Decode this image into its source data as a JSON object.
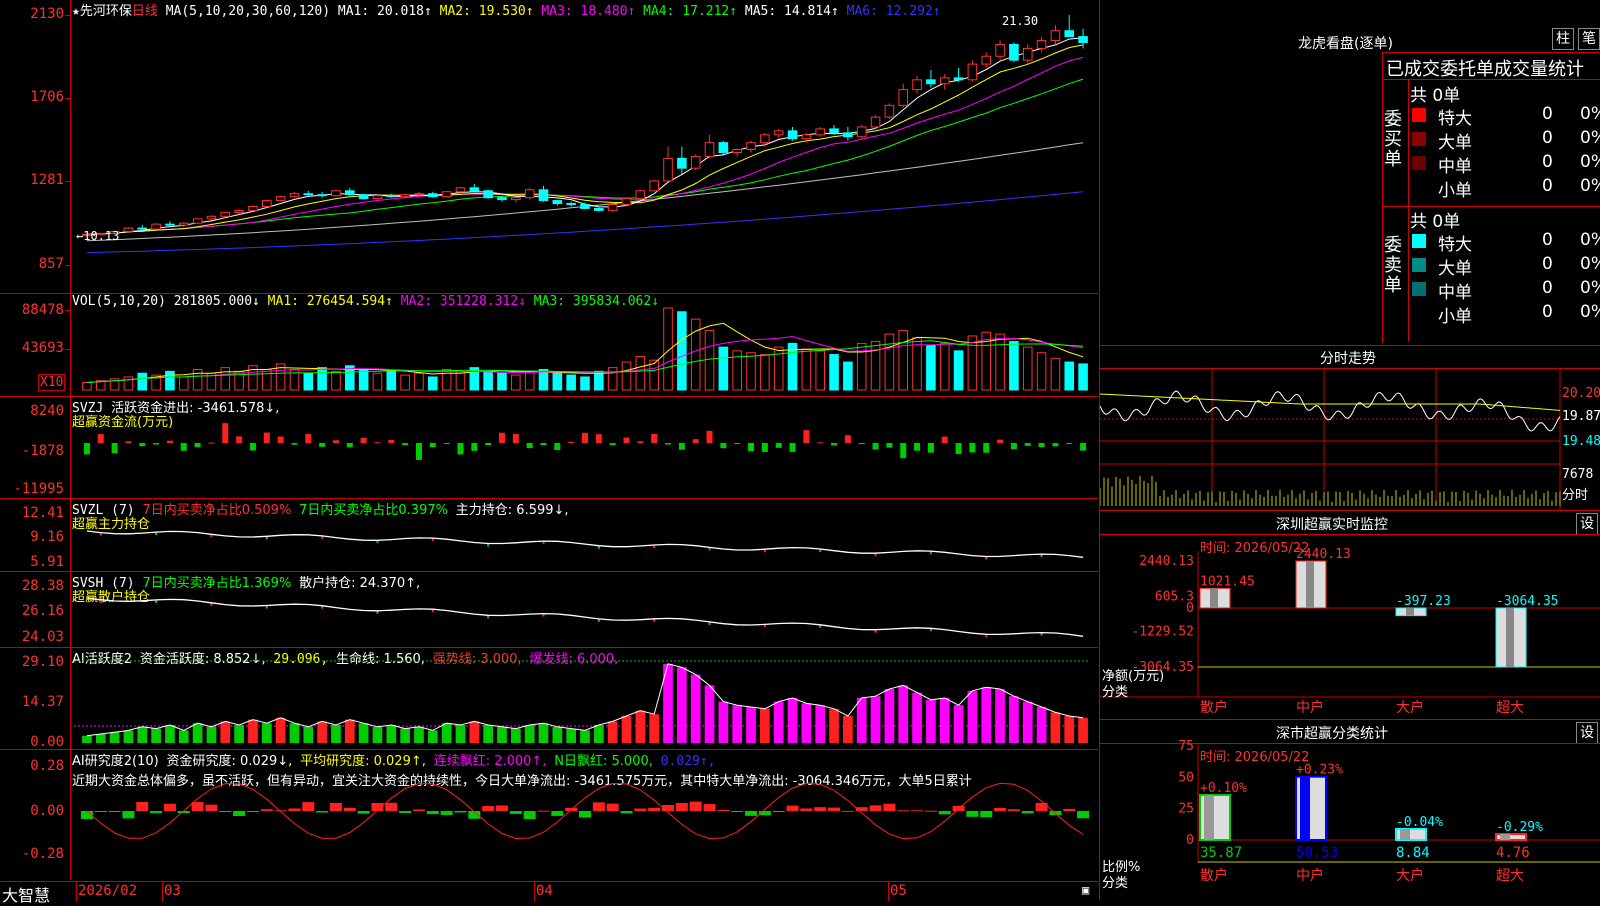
{
  "stock": {
    "star": "★",
    "name": "先河环保",
    "period": "日线"
  },
  "ma": {
    "label": "MA(5,10,20,30,60,120)",
    "items": [
      {
        "text": "MA1: 20.018↑",
        "color": "#ffffff"
      },
      {
        "text": "MA2: 19.530↑",
        "color": "#ffff00"
      },
      {
        "text": "MA3: 18.480↑",
        "color": "#ff00ff"
      },
      {
        "text": "MA4: 17.212↑",
        "color": "#00ff00"
      },
      {
        "text": "MA5: 14.814↑",
        "color": "#ffffff"
      },
      {
        "text": "MA6: 12.292↑",
        "color": "#3333ff"
      }
    ],
    "high_label": "21.30",
    "low_label": "10.13"
  },
  "price_axis": [
    "2130",
    "1706",
    "1281",
    "857"
  ],
  "vol": {
    "label": "VOL(5,10,20)",
    "value": "281805.000↓",
    "ma1": "MA1: 276454.594↑",
    "ma2": "MA2: 351228.312↓",
    "ma3": "MA3: 395834.062↓",
    "axis": [
      "88478",
      "43693"
    ],
    "unit": "X10"
  },
  "svzj": {
    "label": "SVZJ",
    "text": "活跃资金进出: -3461.578↓,",
    "sub": "超赢资金流(万元)",
    "axis": [
      "8240",
      "-1878",
      "-11995"
    ]
  },
  "svzl": {
    "label": "SVZL (7)",
    "t1": "7日内买卖净占比0.509%",
    "t2": "7日内买卖净占比0.397%",
    "t3": "主力持仓: 6.599↓,",
    "sub": "超赢主力持仓",
    "axis": [
      "12.41",
      "9.16",
      "5.91"
    ]
  },
  "svsh": {
    "label": "SVSH (7)",
    "t1": "7日内买卖净占比1.369%",
    "t2": "散户持仓: 24.370↑,",
    "sub": "超赢散户持仓",
    "axis": [
      "28.38",
      "26.16",
      "24.03"
    ]
  },
  "ai1": {
    "label": "AI活跃度2",
    "t1": "资金活跃度: 8.852↓,",
    "t2": "29.096,",
    "t3": "生命线: 1.560,",
    "t4": "强势线: 3.000,",
    "t5": "爆发线: 6.000,",
    "axis": [
      "29.10",
      "14.37",
      "0.00"
    ]
  },
  "ai2": {
    "label": "AI研究度2(10)",
    "t1": "资金研究度: 0.029↓,",
    "t2": "平均研究度: 0.029↑,",
    "t3": "连续飘红: 2.000↑,",
    "t4": "N日飘红: 5.000,",
    "t5": "0.029↑,",
    "comment": "近期大资金总体偏多，虽不活跃，但有异动，宜关注大资金的持续性，今日大单净流出: -3461.575万元，其中特大单净流出: -3064.346万元，大单5日累计",
    "axis": [
      "0.28",
      "0.00",
      "-0.28"
    ]
  },
  "bottom_bar": {
    "brand": "大智慧",
    "dates": [
      "2026/02",
      "03",
      "04",
      "05"
    ]
  },
  "dragon": {
    "title": "龙虎看盘(逐单)",
    "btn_bar": "柱",
    "btn_pen": "笔",
    "subtitle": "已成交委托单成交量统计",
    "buy_side": "委买单",
    "sell_side": "委卖单",
    "buy_total": "共 0单",
    "sell_total": "共 0单",
    "buy_rows": [
      {
        "name": "特大",
        "count": "0",
        "pct": "0%",
        "color": "#ff0000"
      },
      {
        "name": "大单",
        "count": "0",
        "pct": "0%",
        "color": "#8b0000"
      },
      {
        "name": "中单",
        "count": "0",
        "pct": "0%",
        "color": "#6b0000"
      },
      {
        "name": "小单",
        "count": "0",
        "pct": "0%",
        "color": ""
      }
    ],
    "sell_rows": [
      {
        "name": "特大",
        "count": "0",
        "pct": "0%",
        "color": "#00ffff"
      },
      {
        "name": "大单",
        "count": "0",
        "pct": "0%",
        "color": "#008b8b"
      },
      {
        "name": "中单",
        "count": "0",
        "pct": "0%",
        "color": "#007070"
      },
      {
        "name": "小单",
        "count": "0",
        "pct": "0%",
        "color": ""
      }
    ]
  },
  "intraday": {
    "title": "分时走势",
    "axis": [
      "20.20",
      "19.87",
      "19.48"
    ],
    "vol_label": "7678",
    "vol_sub": "分时"
  },
  "sz_monitor": {
    "title": "深圳超赢实时监控",
    "btn": "设",
    "time": "时间: 2026/05/22",
    "axis": [
      "2440.13",
      "605.3",
      "0",
      "-1229.52",
      "-3064.35"
    ],
    "y_caption": "净额(万元)",
    "x_caption": "分类",
    "categories": [
      "散户",
      "中户",
      "大户",
      "超大"
    ],
    "values": [
      "1021.45",
      "2440.13",
      "-397.23",
      "-3064.35"
    ]
  },
  "sz_class": {
    "title": "深市超赢分类统计",
    "btn": "设",
    "time": "时间: 2026/05/22",
    "axis": [
      "75",
      "50",
      "25",
      "0"
    ],
    "y_caption": "比例%",
    "x_caption": "分类",
    "categories": [
      "散户",
      "中户",
      "大户",
      "超大"
    ],
    "values": [
      "35.87",
      "50.53",
      "8.84",
      "4.76"
    ],
    "changes": [
      "+0.10%",
      "+0.23%",
      "-0.04%",
      "-0.29%"
    ]
  },
  "chart_data": {
    "type": "candlestick",
    "candles": [
      [
        10.1,
        10.15,
        10.08,
        10.13
      ],
      [
        10.13,
        10.2,
        10.1,
        10.18
      ],
      [
        10.18,
        10.3,
        10.15,
        10.28
      ],
      [
        10.28,
        10.5,
        10.25,
        10.45
      ],
      [
        10.45,
        10.6,
        10.3,
        10.4
      ],
      [
        10.4,
        10.7,
        10.35,
        10.65
      ],
      [
        10.65,
        10.8,
        10.55,
        10.6
      ],
      [
        10.6,
        10.75,
        10.5,
        10.7
      ],
      [
        10.7,
        10.95,
        10.65,
        10.92
      ],
      [
        10.92,
        11.1,
        10.85,
        11.05
      ],
      [
        11.05,
        11.3,
        11.0,
        11.25
      ],
      [
        11.25,
        11.4,
        11.15,
        11.35
      ],
      [
        11.35,
        11.6,
        11.3,
        11.55
      ],
      [
        11.55,
        11.9,
        11.5,
        11.85
      ],
      [
        11.85,
        12.1,
        11.8,
        12.05
      ],
      [
        12.05,
        12.3,
        12.0,
        12.2
      ],
      [
        12.2,
        12.35,
        12.05,
        12.15
      ],
      [
        12.15,
        12.3,
        12.0,
        12.1
      ],
      [
        12.1,
        12.4,
        12.05,
        12.35
      ],
      [
        12.35,
        12.5,
        12.1,
        12.15
      ],
      [
        12.15,
        12.2,
        11.9,
        11.95
      ],
      [
        11.95,
        12.15,
        11.9,
        12.1
      ],
      [
        12.1,
        12.2,
        12.0,
        12.05
      ],
      [
        12.05,
        12.2,
        11.95,
        12.15
      ],
      [
        12.15,
        12.3,
        12.05,
        12.2
      ],
      [
        12.2,
        12.3,
        12.0,
        12.05
      ],
      [
        12.05,
        12.35,
        12.0,
        12.3
      ],
      [
        12.3,
        12.55,
        12.2,
        12.5
      ],
      [
        12.5,
        12.7,
        12.3,
        12.35
      ],
      [
        12.35,
        12.4,
        11.95,
        12.0
      ],
      [
        12.0,
        12.1,
        11.8,
        11.9
      ],
      [
        11.9,
        12.05,
        11.75,
        12.0
      ],
      [
        12.0,
        12.5,
        11.9,
        12.4
      ],
      [
        12.4,
        12.6,
        11.8,
        11.85
      ],
      [
        11.85,
        11.9,
        11.6,
        11.7
      ],
      [
        11.7,
        11.8,
        11.55,
        11.65
      ],
      [
        11.65,
        11.75,
        11.4,
        11.45
      ],
      [
        11.45,
        11.55,
        11.3,
        11.35
      ],
      [
        11.35,
        11.7,
        11.3,
        11.65
      ],
      [
        11.65,
        12.0,
        11.6,
        11.95
      ],
      [
        11.95,
        12.4,
        11.9,
        12.35
      ],
      [
        12.35,
        12.9,
        12.3,
        12.85
      ],
      [
        12.85,
        14.6,
        12.8,
        14.0
      ],
      [
        14.0,
        14.6,
        13.2,
        13.5
      ],
      [
        13.5,
        14.2,
        13.4,
        14.1
      ],
      [
        14.1,
        15.2,
        14.0,
        14.8
      ],
      [
        14.8,
        14.9,
        14.2,
        14.3
      ],
      [
        14.3,
        14.5,
        14.1,
        14.45
      ],
      [
        14.45,
        14.9,
        14.3,
        14.8
      ],
      [
        14.8,
        15.3,
        14.6,
        15.2
      ],
      [
        15.2,
        15.5,
        15.0,
        15.4
      ],
      [
        15.4,
        15.6,
        14.9,
        15.0
      ],
      [
        15.0,
        15.3,
        14.8,
        15.2
      ],
      [
        15.2,
        15.6,
        15.1,
        15.5
      ],
      [
        15.5,
        15.7,
        15.2,
        15.3
      ],
      [
        15.3,
        15.6,
        14.9,
        15.1
      ],
      [
        15.1,
        15.7,
        15.0,
        15.6
      ],
      [
        15.6,
        16.2,
        15.5,
        16.1
      ],
      [
        16.1,
        16.8,
        16.0,
        16.7
      ],
      [
        16.7,
        17.8,
        16.6,
        17.5
      ],
      [
        17.5,
        18.2,
        17.3,
        18.0
      ],
      [
        18.0,
        18.5,
        17.6,
        17.8
      ],
      [
        17.8,
        18.3,
        17.5,
        18.1
      ],
      [
        18.1,
        18.6,
        17.9,
        18.0
      ],
      [
        18.0,
        19.0,
        17.9,
        18.8
      ],
      [
        18.8,
        19.4,
        18.6,
        19.2
      ],
      [
        19.2,
        20.0,
        19.0,
        19.8
      ],
      [
        19.8,
        19.9,
        18.9,
        19.0
      ],
      [
        19.0,
        19.8,
        18.8,
        19.6
      ],
      [
        19.6,
        20.2,
        19.4,
        20.0
      ],
      [
        20.0,
        20.8,
        19.8,
        20.5
      ],
      [
        20.5,
        21.3,
        20.3,
        20.2
      ],
      [
        20.2,
        20.6,
        19.6,
        19.9
      ]
    ],
    "volumes": [
      8,
      10,
      12,
      14,
      18,
      16,
      20,
      14,
      22,
      18,
      24,
      20,
      26,
      22,
      28,
      22,
      18,
      24,
      20,
      26,
      22,
      18,
      20,
      16,
      18,
      14,
      22,
      20,
      24,
      20,
      18,
      16,
      20,
      22,
      18,
      16,
      14,
      20,
      24,
      30,
      36,
      32,
      88,
      84,
      76,
      64,
      46,
      42,
      40,
      38,
      46,
      50,
      44,
      42,
      38,
      30,
      50,
      52,
      60,
      64,
      56,
      48,
      50,
      42,
      58,
      62,
      60,
      52,
      46,
      40,
      34,
      30,
      28
    ]
  }
}
